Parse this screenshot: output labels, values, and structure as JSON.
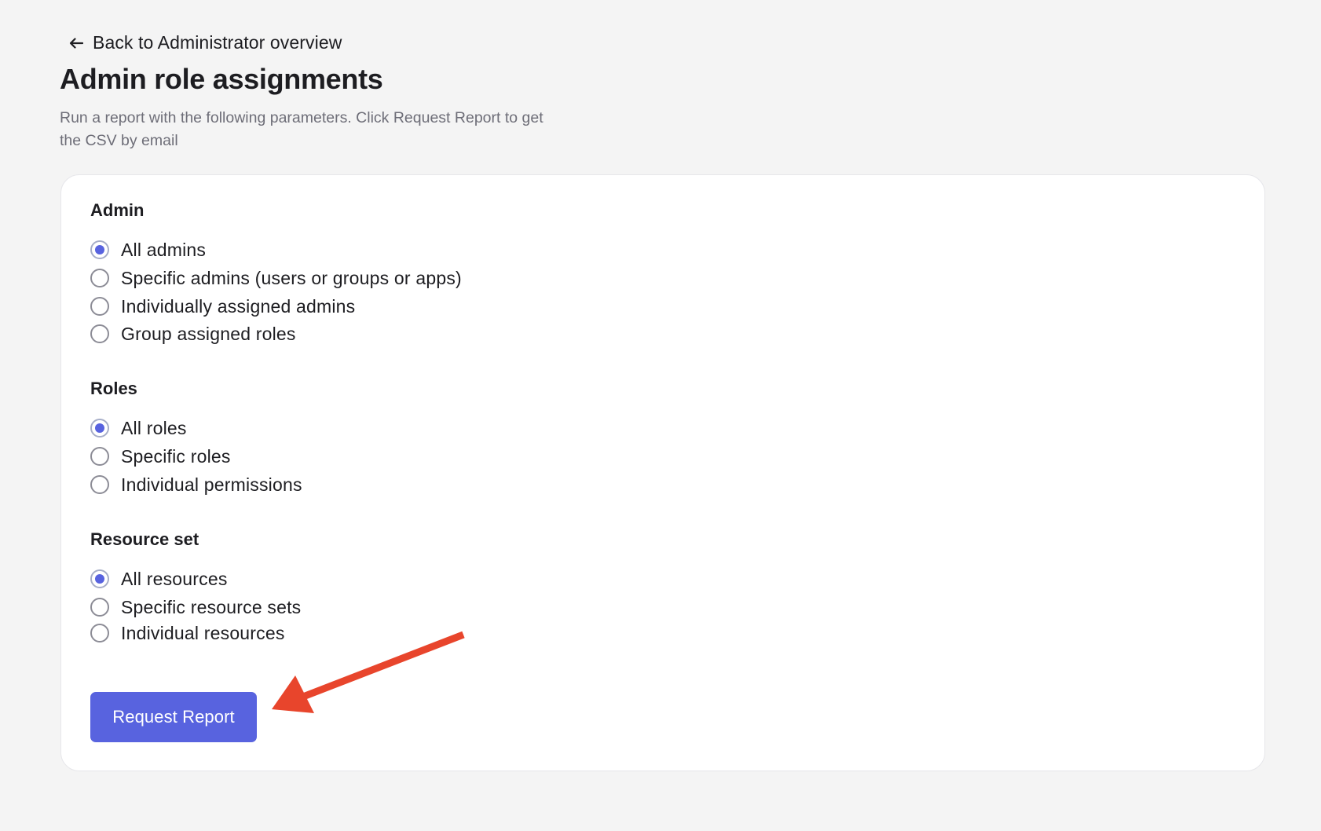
{
  "navigation": {
    "back_label": "Back to Administrator overview"
  },
  "page": {
    "title": "Admin role assignments",
    "description": "Run a report with the following parameters. Click Request Report to get the CSV by email"
  },
  "form": {
    "sections": [
      {
        "legend": "Admin",
        "options": [
          {
            "label": "All admins",
            "checked": true
          },
          {
            "label": "Specific admins (users or groups or apps)",
            "checked": false
          },
          {
            "label": "Individually assigned admins",
            "checked": false
          },
          {
            "label": "Group assigned roles",
            "checked": false
          }
        ]
      },
      {
        "legend": "Roles",
        "options": [
          {
            "label": "All roles",
            "checked": true
          },
          {
            "label": "Specific roles",
            "checked": false
          },
          {
            "label": "Individual permissions",
            "checked": false
          }
        ]
      },
      {
        "legend": "Resource set",
        "options": [
          {
            "label": "All resources",
            "checked": true
          },
          {
            "label": "Specific resource sets",
            "checked": false
          },
          {
            "label": "Individual resources",
            "checked": false
          }
        ]
      }
    ],
    "submit_label": "Request Report"
  },
  "colors": {
    "page_background": "#f4f4f4",
    "card_background": "#ffffff",
    "primary": "#5863df",
    "annotation_arrow": "#e8452c",
    "description_text": "#6e6e78"
  },
  "icons": {
    "back": "arrow-left-icon",
    "annotation": "red-arrow-annotation"
  }
}
